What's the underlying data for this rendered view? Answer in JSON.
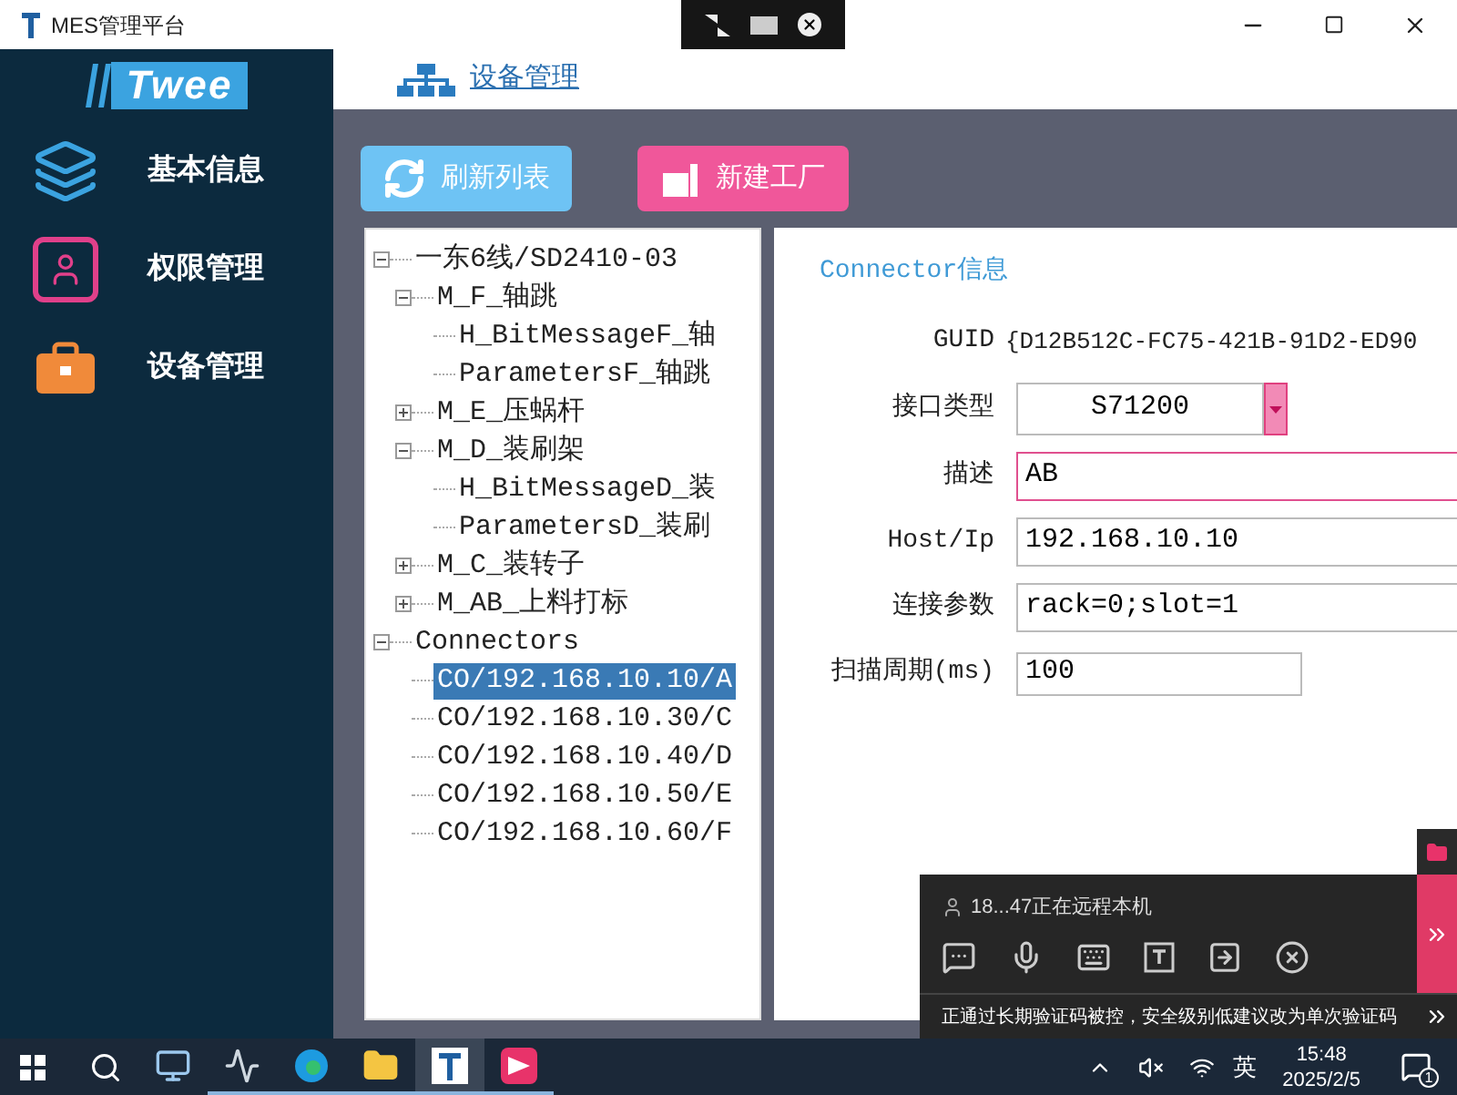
{
  "window": {
    "title": "MES管理平台"
  },
  "sidebar": {
    "logo": "Twee",
    "items": [
      {
        "label": "基本信息"
      },
      {
        "label": "权限管理"
      },
      {
        "label": "设备管理"
      }
    ]
  },
  "header": {
    "title": "设备管理"
  },
  "toolbar": [
    {
      "label": "刷新列表",
      "kind": "refresh"
    },
    {
      "label": "新建工厂",
      "kind": "factory"
    }
  ],
  "tree": [
    {
      "label": "一东6线/SD2410-03",
      "expanded": true,
      "selected": false,
      "children": [
        {
          "label": "M_F_轴跳",
          "expanded": true,
          "selected": false,
          "children": [
            {
              "label": "H_BitMessageF_轴",
              "selected": false
            },
            {
              "label": "ParametersF_轴跳",
              "selected": false
            }
          ]
        },
        {
          "label": "M_E_压蜗杆",
          "expanded": false,
          "selected": false
        },
        {
          "label": "M_D_装刷架",
          "expanded": true,
          "selected": false,
          "children": [
            {
              "label": "H_BitMessageD_装",
              "selected": false
            },
            {
              "label": "ParametersD_装刷",
              "selected": false
            }
          ]
        },
        {
          "label": "M_C_装转子",
          "expanded": false,
          "selected": false
        },
        {
          "label": "M_AB_上料打标",
          "expanded": false,
          "selected": false
        }
      ]
    },
    {
      "label": "Connectors",
      "expanded": true,
      "selected": false,
      "children": [
        {
          "label": "CO/192.168.10.10/A",
          "selected": true
        },
        {
          "label": "CO/192.168.10.30/C",
          "selected": false
        },
        {
          "label": "CO/192.168.10.40/D",
          "selected": false
        },
        {
          "label": "CO/192.168.10.50/E",
          "selected": false
        },
        {
          "label": "CO/192.168.10.60/F",
          "selected": false
        }
      ]
    }
  ],
  "detail": {
    "title": "Connector信息",
    "fields": [
      {
        "label": "GUID",
        "kind": "text",
        "value": "{D12B512C-FC75-421B-91D2-ED90"
      },
      {
        "label": "接口类型",
        "kind": "select",
        "value": "S71200"
      },
      {
        "label": "描述",
        "kind": "input",
        "value": "AB",
        "focused": true
      },
      {
        "label": "Host/Ip",
        "kind": "input",
        "value": "192.168.10.10",
        "focused": false
      },
      {
        "label": "连接参数",
        "kind": "input",
        "value": "rack=0;slot=1",
        "focused": false
      },
      {
        "label": "扫描周期(ms)",
        "kind": "short",
        "value": "100",
        "focused": false
      }
    ]
  },
  "remote": {
    "user": "18...47正在远程本机",
    "notice": "正通过长期验证码被控，安全级别低建议改为单次验证码"
  },
  "taskbar": {
    "apps": [
      {
        "kind": "computer",
        "running": false,
        "selected": false
      },
      {
        "kind": "monitor",
        "running": true,
        "selected": false
      },
      {
        "kind": "edge",
        "running": true,
        "selected": false
      },
      {
        "kind": "folder",
        "running": true,
        "selected": false
      },
      {
        "kind": "t",
        "running": true,
        "selected": true
      },
      {
        "kind": "pink",
        "running": true,
        "selected": false
      }
    ],
    "ime": "英",
    "time": "15:48",
    "date": "2025/2/5",
    "notifications": "1"
  }
}
